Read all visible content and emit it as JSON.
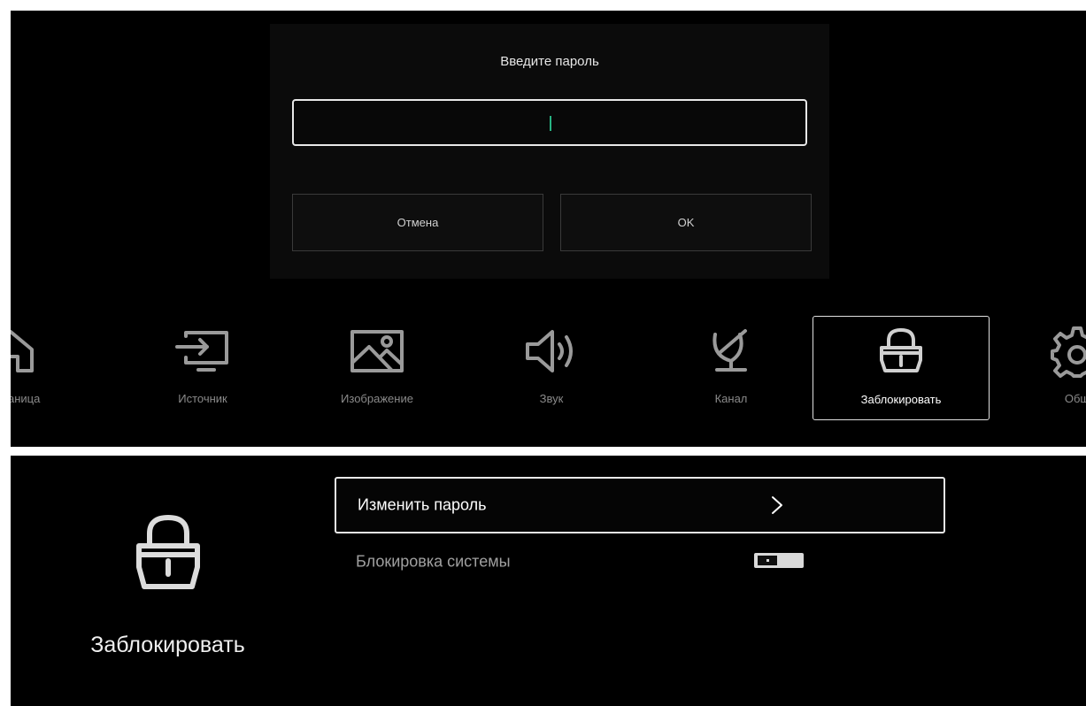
{
  "password_dialog": {
    "title": "Введите пароль",
    "password_value": "",
    "cancel_label": "Отмена",
    "ok_label": "OK",
    "caret_color": "#27b383"
  },
  "nav": {
    "items": [
      {
        "label": "я страница",
        "icon": "home-icon"
      },
      {
        "label": "Источник",
        "icon": "source-input-icon"
      },
      {
        "label": "Изображение",
        "icon": "picture-icon"
      },
      {
        "label": "Звук",
        "icon": "speaker-icon"
      },
      {
        "label": "Канал",
        "icon": "satellite-dish-icon"
      },
      {
        "label": "Заблокировать",
        "icon": "lock-icon",
        "active": true
      },
      {
        "label": "Общ",
        "icon": "gear-icon"
      }
    ]
  },
  "lock_page": {
    "title": "Заблокировать",
    "icon": "lock-icon",
    "menu": [
      {
        "label": "Изменить пароль",
        "icon": "chevron-right-icon",
        "selected": true
      },
      {
        "label": "Блокировка системы",
        "toggle": "off"
      }
    ]
  }
}
